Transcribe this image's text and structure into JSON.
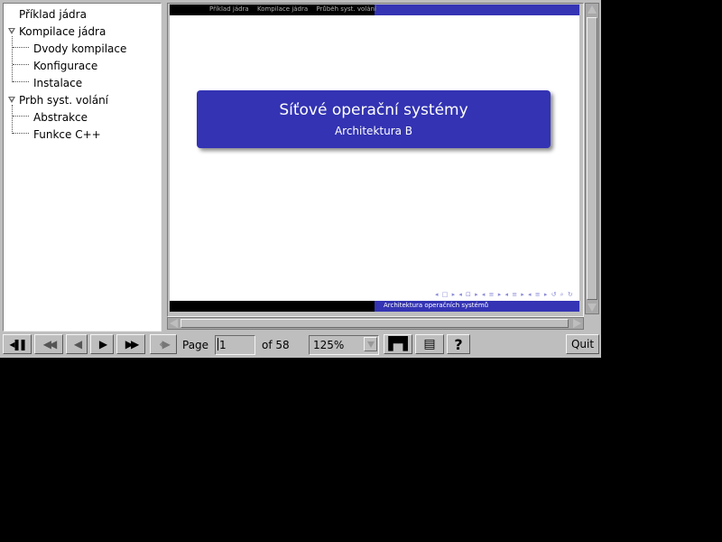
{
  "outline": {
    "items": [
      {
        "label": "Příklad jádra"
      },
      {
        "label": "Kompilace jádra",
        "children": [
          "Dvody kompilace",
          "Konfigurace",
          "Instalace"
        ]
      },
      {
        "label": "Prbh syst. volání",
        "children": [
          "Abstrakce",
          "Funkce C++"
        ]
      }
    ]
  },
  "slide": {
    "header_nav": [
      "Příklad jádra",
      "Kompilace jádra",
      "Průběh syst. volání"
    ],
    "title": "Síťové operační systémy",
    "subtitle": "Architektura B",
    "footer_label": "Architektura operačních systémů",
    "nav_symbols": "◂ □ ▸ ◂ ⊡ ▸ ◂ ≡ ▸ ◂ ≡ ▸ ◂ ≡ ▸  ↺ ⌕ ↻",
    "colors": {
      "accent": "#3333b3",
      "bar": "#000000"
    }
  },
  "toolbar": {
    "page_label": "Page",
    "page_value": "1",
    "page_total": "of 58",
    "zoom_value": "125%",
    "quit_label": "Quit",
    "buttons": [
      "play-pause-icon",
      "first-page-icon",
      "prev-page-icon",
      "next-page-icon",
      "last-page-icon",
      "history-back-icon",
      "find-icon",
      "print-icon",
      "help-icon"
    ]
  }
}
